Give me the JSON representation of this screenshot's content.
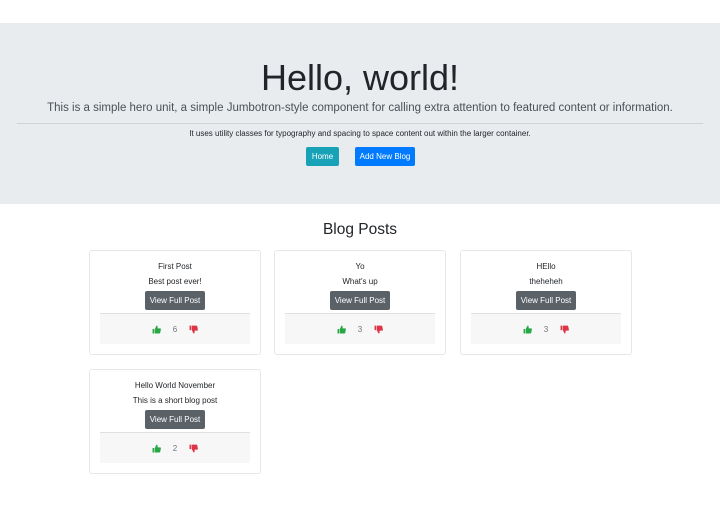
{
  "jumbotron": {
    "title": "Hello, world!",
    "lead": "This is a simple hero unit, a simple Jumbotron-style component for calling extra attention to featured content or information.",
    "sub": "It uses utility classes for typography and spacing to space content out within the larger container.",
    "home_label": "Home",
    "add_label": "Add New Blog"
  },
  "section_title": "Blog Posts",
  "view_label": "View Full Post",
  "colors": {
    "like": "#28a745",
    "dislike": "#dc3545",
    "home": "#17a2b8",
    "add": "#007bff",
    "view": "#5a6268"
  },
  "posts": [
    {
      "title": "First Post",
      "text": "Best post ever!",
      "likes": "6"
    },
    {
      "title": "Yo",
      "text": "What's up",
      "likes": "3"
    },
    {
      "title": "HEllo",
      "text": "theheheh",
      "likes": "3"
    },
    {
      "title": "Hello World November",
      "text": "This is a short blog post",
      "likes": "2"
    }
  ]
}
